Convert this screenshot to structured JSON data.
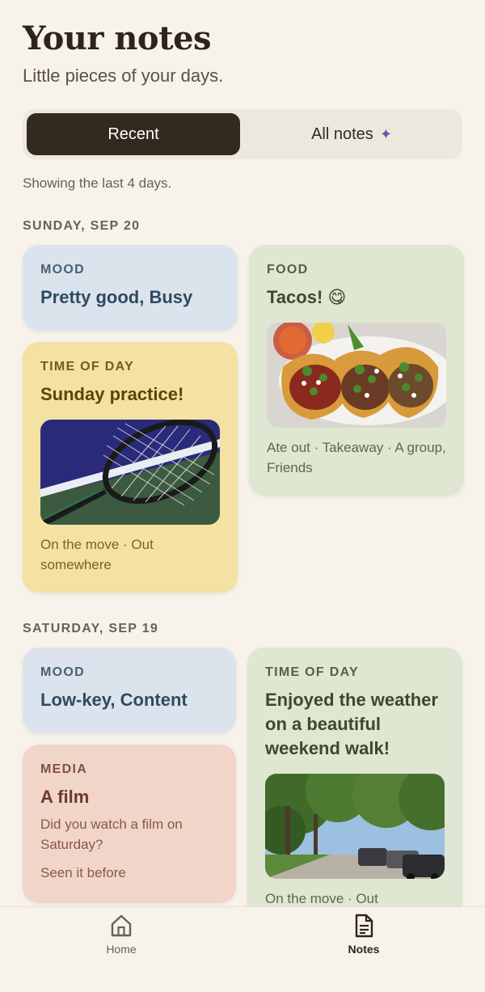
{
  "header": {
    "title": "Your notes",
    "subtitle": "Little pieces of your days."
  },
  "segmented": {
    "recent": "Recent",
    "all_notes": "All notes",
    "sparkle": "✦"
  },
  "showing_text": "Showing the last 4 days.",
  "days": [
    {
      "date": "SUNDAY, SEP 20",
      "mood": {
        "category": "MOOD",
        "text": "Pretty good, Busy"
      },
      "food": {
        "category": "FOOD",
        "text": "Tacos! 😋",
        "photo": "tacos-photo",
        "meta": "Ate out · Takeaway · A group, Friends"
      },
      "time": {
        "category": "TIME OF DAY",
        "text": "Sunday practice!",
        "photo": "tennis-racket-photo",
        "meta": "On the move · Out somewhere"
      }
    },
    {
      "date": "SATURDAY, SEP 19",
      "mood": {
        "category": "MOOD",
        "text": "Low-key, Content"
      },
      "media": {
        "category": "MEDIA",
        "text": "A film",
        "question": "Did you watch a film on Saturday?",
        "answer": "Seen it before"
      },
      "time": {
        "category": "TIME OF DAY",
        "text": "Enjoyed the weather on a beautiful weekend walk!",
        "photo": "street-trees-photo",
        "meta": "On the move · Out somewhere"
      }
    }
  ],
  "tabs": {
    "home": "Home",
    "notes": "Notes"
  },
  "colors": {
    "background": "#f7f2ea",
    "active_segment": "#33291f",
    "mood_card": "#dbe4ec",
    "time_card_yellow": "#f4e1a4",
    "food_card": "#dfe6d1",
    "media_card": "#f1d5c8",
    "sparkle": "#6d4fb3"
  }
}
